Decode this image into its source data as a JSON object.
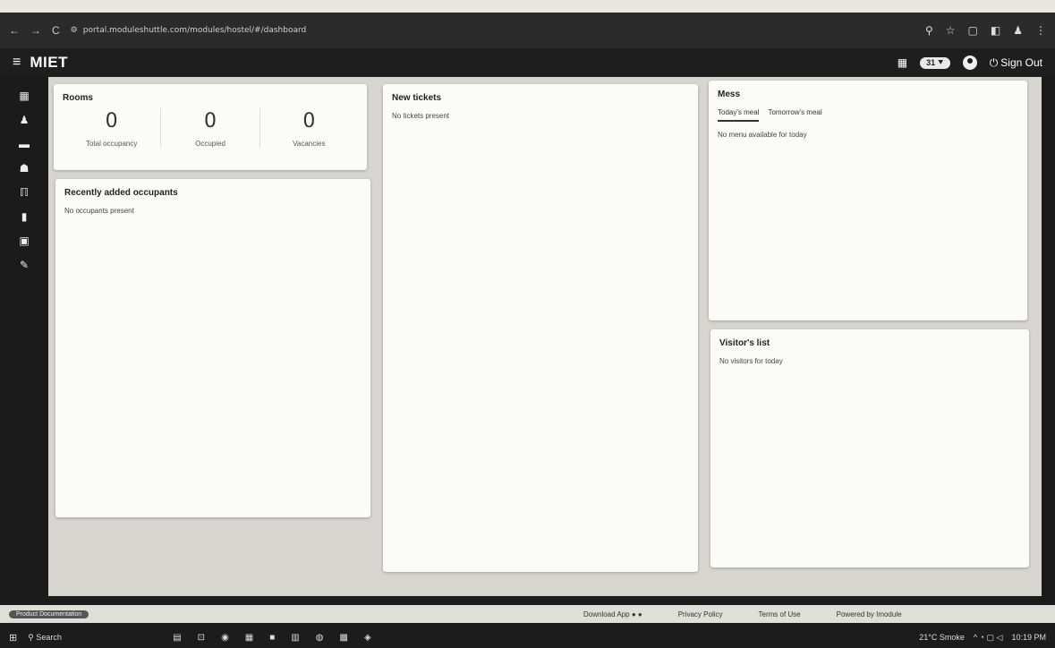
{
  "browser": {
    "url": "portal.moduleshuttle.com/modules/hostel/#/dashboard",
    "nav_back": "←",
    "nav_forward": "→",
    "nav_reload": "C",
    "right_icons": [
      "⚲",
      "☆",
      "▢",
      "◧",
      "♟",
      "⋮"
    ]
  },
  "header": {
    "menu_glyph": "≡",
    "brand": "MIET",
    "grid_glyph": "▦",
    "pill_label": "31 ⯆",
    "signout_glyph": "⏻",
    "signout_label": "Sign Out"
  },
  "sidebar": {
    "items": [
      {
        "name": "dashboard-icon",
        "glyph": "▦"
      },
      {
        "name": "user-icon",
        "glyph": "♟"
      },
      {
        "name": "bed-icon",
        "glyph": "▬"
      },
      {
        "name": "food-icon",
        "glyph": "☗"
      },
      {
        "name": "mess-icon",
        "glyph": "ℿ"
      },
      {
        "name": "library-icon",
        "glyph": "▮"
      },
      {
        "name": "visitor-icon",
        "glyph": "▣"
      },
      {
        "name": "edit-icon",
        "glyph": "✎"
      }
    ]
  },
  "rooms": {
    "title": "Rooms",
    "stats": [
      {
        "value": "0",
        "label": "Total occupancy"
      },
      {
        "value": "0",
        "label": "Occupied"
      },
      {
        "value": "0",
        "label": "Vacancies"
      }
    ]
  },
  "recent": {
    "title": "Recently added occupants",
    "empty": "No occupants present"
  },
  "tickets": {
    "title": "New tickets",
    "empty": "No tickets present"
  },
  "mess": {
    "title": "Mess",
    "tabs": [
      "Today's meal",
      "Tomorrow's meal"
    ],
    "empty": "No menu available for today"
  },
  "visitors": {
    "title": "Visitor's list",
    "empty": "No visitors for today"
  },
  "footer": {
    "docs": "Product Documentation",
    "download": "Download App ● ●",
    "privacy": "Privacy Policy",
    "terms": "Terms of Use",
    "powered": "Powered by Imodule"
  },
  "taskbar": {
    "start": "⊞",
    "search": "⚲ Search",
    "apps": [
      "▤",
      "⊡",
      "◉",
      "▦",
      "■",
      "▥",
      "◍",
      "▩",
      "◈"
    ],
    "weather": "21°C Smoke",
    "time": "10:19 PM",
    "tray_icons": "^ ◔ ▢ ◁"
  }
}
